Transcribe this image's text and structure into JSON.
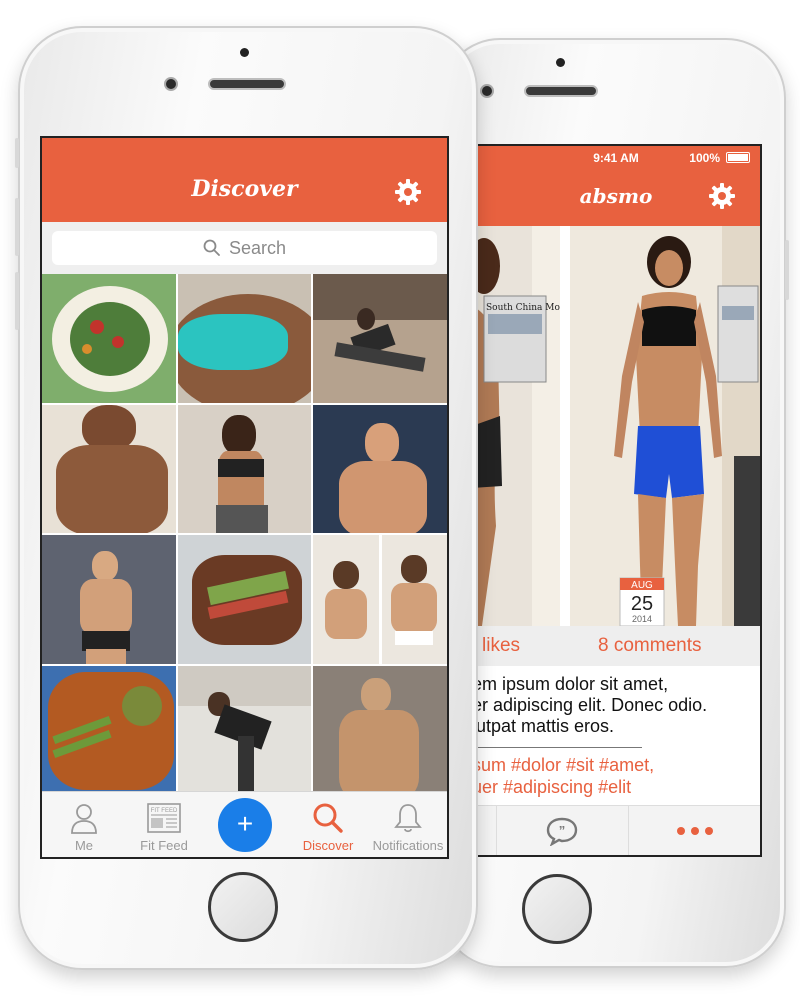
{
  "front": {
    "title": "Discover",
    "search_placeholder": "Search",
    "tabs": [
      {
        "label": "Me",
        "icon": "person-icon"
      },
      {
        "label": "Fit Feed",
        "icon": "newspaper-icon"
      },
      {
        "label": "+",
        "icon": "plus-icon"
      },
      {
        "label": "Discover",
        "icon": "search-icon"
      },
      {
        "label": "Notifications",
        "icon": "bell-icon"
      }
    ],
    "fit_feed_badge": "FIT FEED"
  },
  "back": {
    "status_time": "9:41 AM",
    "battery": "100%",
    "title": "absmo",
    "likes": "likes",
    "comments": "8 comments",
    "caption_lines": [
      "em ipsum dolor sit amet,",
      "er adipiscing elit. Donec odio.",
      "lutpat mattis eros."
    ],
    "tag_lines": [
      "sum #dolor #sit #amet,",
      "uer #adipiscing #elit"
    ],
    "date_month": "AUG",
    "date_day": "25",
    "date_year": "2014",
    "newspaper_text": "South China Morn"
  },
  "colors": {
    "accent": "#e8613f",
    "blue_button": "#1a7ee8"
  }
}
